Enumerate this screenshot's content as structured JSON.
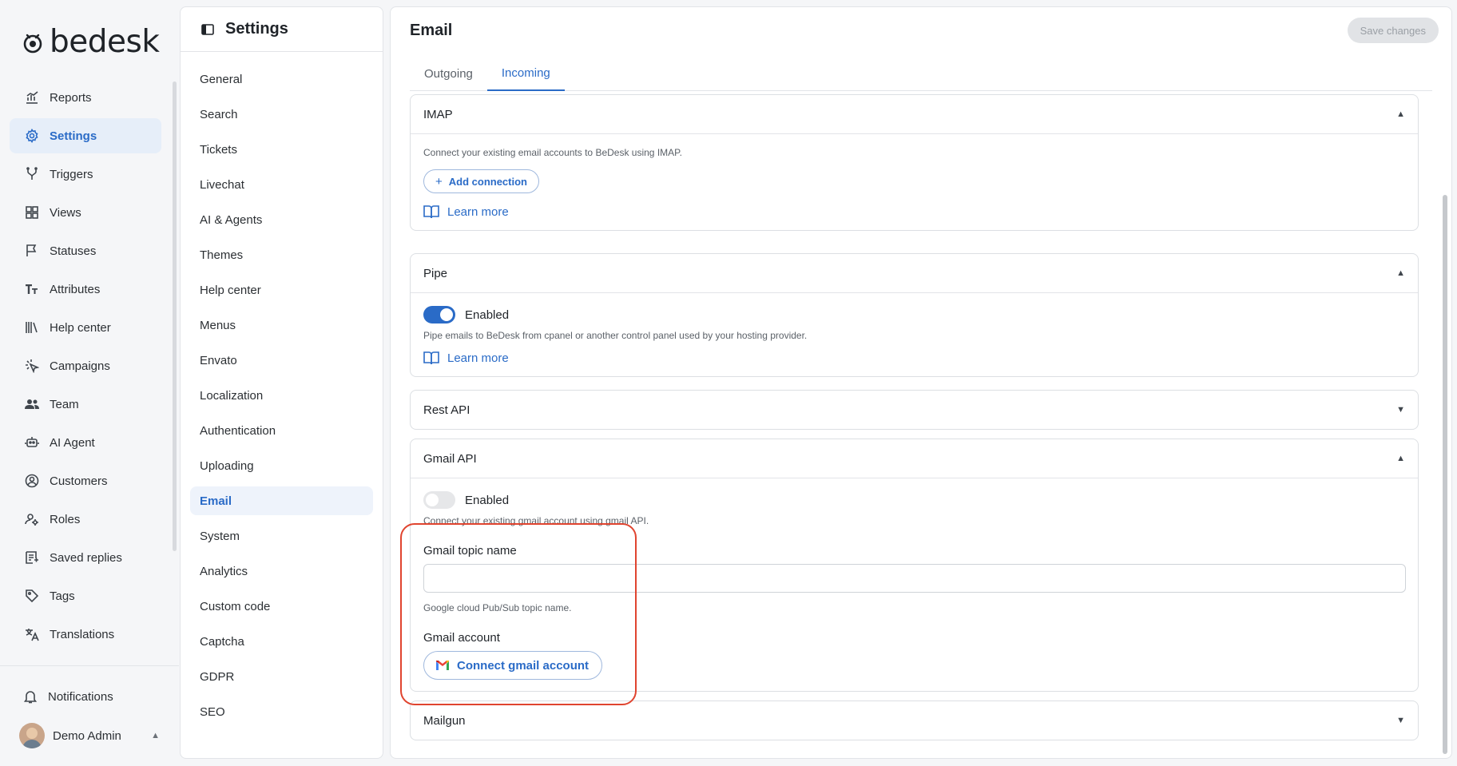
{
  "brand": {
    "name": "bedesk"
  },
  "nav": {
    "items": [
      {
        "label": "Reports",
        "icon": "reports-icon"
      },
      {
        "label": "Settings",
        "icon": "gear-icon",
        "active": true
      },
      {
        "label": "Triggers",
        "icon": "triggers-icon"
      },
      {
        "label": "Views",
        "icon": "views-icon"
      },
      {
        "label": "Statuses",
        "icon": "flag-icon"
      },
      {
        "label": "Attributes",
        "icon": "text-icon"
      },
      {
        "label": "Help center",
        "icon": "library-icon"
      },
      {
        "label": "Campaigns",
        "icon": "campaigns-icon"
      },
      {
        "label": "Team",
        "icon": "team-icon"
      },
      {
        "label": "AI Agent",
        "icon": "robot-icon"
      },
      {
        "label": "Customers",
        "icon": "customer-icon"
      },
      {
        "label": "Roles",
        "icon": "roles-icon"
      },
      {
        "label": "Saved replies",
        "icon": "saved-replies-icon"
      },
      {
        "label": "Tags",
        "icon": "tag-icon"
      },
      {
        "label": "Translations",
        "icon": "translate-icon"
      }
    ],
    "notifications_label": "Notifications",
    "user_name": "Demo Admin"
  },
  "settings": {
    "title": "Settings",
    "items": [
      "General",
      "Search",
      "Tickets",
      "Livechat",
      "AI & Agents",
      "Themes",
      "Help center",
      "Menus",
      "Envato",
      "Localization",
      "Authentication",
      "Uploading",
      "Email",
      "System",
      "Analytics",
      "Custom code",
      "Captcha",
      "GDPR",
      "SEO"
    ],
    "active": "Email"
  },
  "main": {
    "title": "Email",
    "save_label": "Save changes",
    "tabs": [
      {
        "label": "Outgoing",
        "active": false
      },
      {
        "label": "Incoming",
        "active": true
      }
    ]
  },
  "imap": {
    "title": "IMAP",
    "description": "Connect your existing email accounts to BeDesk using IMAP.",
    "add_label": "Add connection",
    "learn_label": "Learn more"
  },
  "pipe": {
    "title": "Pipe",
    "enabled_label": "Enabled",
    "enabled": true,
    "description": "Pipe emails to BeDesk from cpanel or another control panel used by your hosting provider.",
    "learn_label": "Learn more"
  },
  "rest_api": {
    "title": "Rest API"
  },
  "gmail_api": {
    "title": "Gmail API",
    "enabled_label": "Enabled",
    "enabled": false,
    "description": "Connect your existing gmail account using gmail API.",
    "topic_label": "Gmail topic name",
    "topic_value": "",
    "topic_hint": "Google cloud Pub/Sub topic name.",
    "account_label": "Gmail account",
    "connect_label": "Connect gmail account"
  },
  "mailgun": {
    "title": "Mailgun"
  },
  "colors": {
    "accent": "#2a6bc7",
    "highlight": "#e0442f"
  }
}
